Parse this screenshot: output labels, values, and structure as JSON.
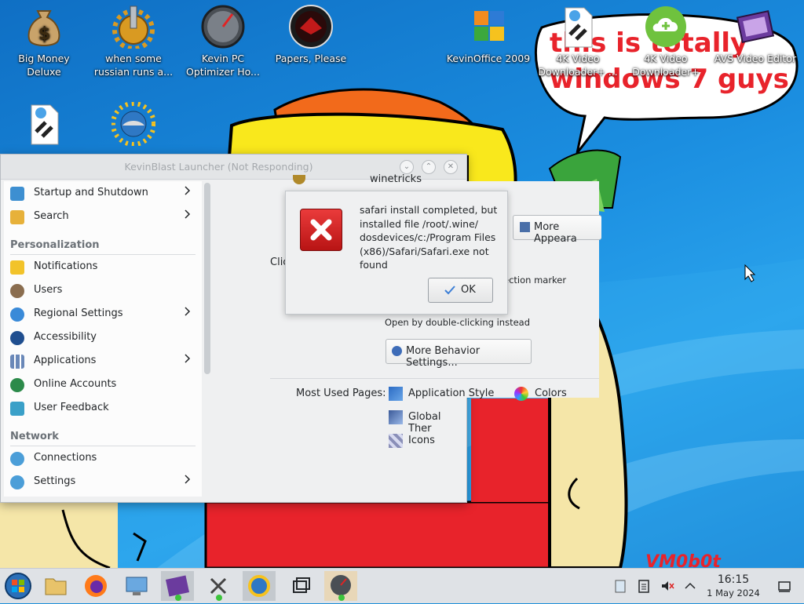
{
  "desktop": {
    "icons": [
      {
        "label": "Big Money Deluxe",
        "icon": "money-bag-icon"
      },
      {
        "label": "when some russian runs a...",
        "icon": "gear-icon"
      },
      {
        "label": "Kevin PC Optimizer Ho...",
        "icon": "speedometer-icon"
      },
      {
        "label": "Papers, Please",
        "icon": "emblem-icon"
      },
      {
        "label": "KevinOffice 2009",
        "icon": "office-icon"
      },
      {
        "label": "4K Video Downloader+ ...",
        "icon": "shortcut-document-icon"
      },
      {
        "label": "4K Video Downloader+",
        "icon": "cloud-download-icon"
      },
      {
        "label": "AVS Video Editor",
        "icon": "film-icon"
      }
    ],
    "row2_icons": [
      {
        "label": "",
        "icon": "shortcut-document-icon"
      },
      {
        "label": "",
        "icon": "sun-globe-icon"
      }
    ],
    "speech_bubble": "this is totally windows 7 guys",
    "watermark": "VM0b0t"
  },
  "launcher": {
    "title": "KevinBlast Launcher (Not Responding)",
    "menu": {
      "items_top": [
        {
          "label": "Startup and Shutdown",
          "icon": "startup-icon",
          "submenu": true
        },
        {
          "label": "Search",
          "icon": "search-icon",
          "submenu": true
        }
      ],
      "personalization_header": "Personalization",
      "personalization_items": [
        {
          "label": "Notifications",
          "icon": "bell-icon",
          "submenu": false
        },
        {
          "label": "Users",
          "icon": "users-icon",
          "submenu": false
        },
        {
          "label": "Regional Settings",
          "icon": "globe-icon",
          "submenu": true
        },
        {
          "label": "Accessibility",
          "icon": "accessibility-icon",
          "submenu": false
        },
        {
          "label": "Applications",
          "icon": "applications-icon",
          "submenu": true
        },
        {
          "label": "Online Accounts",
          "icon": "online-accounts-icon",
          "submenu": false
        },
        {
          "label": "User Feedback",
          "icon": "feedback-icon",
          "submenu": false
        }
      ],
      "network_header": "Network",
      "network_items": [
        {
          "label": "Connections",
          "icon": "connections-icon",
          "submenu": false
        },
        {
          "label": "Settings",
          "icon": "network-settings-icon",
          "submenu": true
        }
      ]
    },
    "panel": {
      "winetricks_label": "winetricks",
      "more_appearance_label": "More Appeara",
      "click_label_fragment": "Clic",
      "selection_marker_fragment": "ection marker",
      "double_click_text": "Open by double-clicking instead",
      "more_behavior_label": "More Behavior Settings...",
      "most_used_label": "Most Used Pages:",
      "pages": [
        {
          "label": "Application Style",
          "icon": "app-style-icon"
        },
        {
          "label": "Colors",
          "icon": "colors-icon"
        },
        {
          "label": "Global Ther",
          "icon": "global-theme-icon"
        },
        {
          "label": "Icons",
          "icon": "icons-page-icon"
        }
      ]
    }
  },
  "error_dialog": {
    "message": "safari install completed, but installed file /root/.wine/ dosdevices/c:/Program Files (x86)/Safari/Safari.exe not found",
    "ok_label": "OK"
  },
  "taskbar": {
    "clock_time": "16:15",
    "clock_date": "1 May 2024"
  },
  "colors": {
    "desktop_blue": "#1a8ed8",
    "error_red": "#d8232a",
    "drawing_red": "#e8232b",
    "drawing_yellow": "#f9e81c"
  }
}
